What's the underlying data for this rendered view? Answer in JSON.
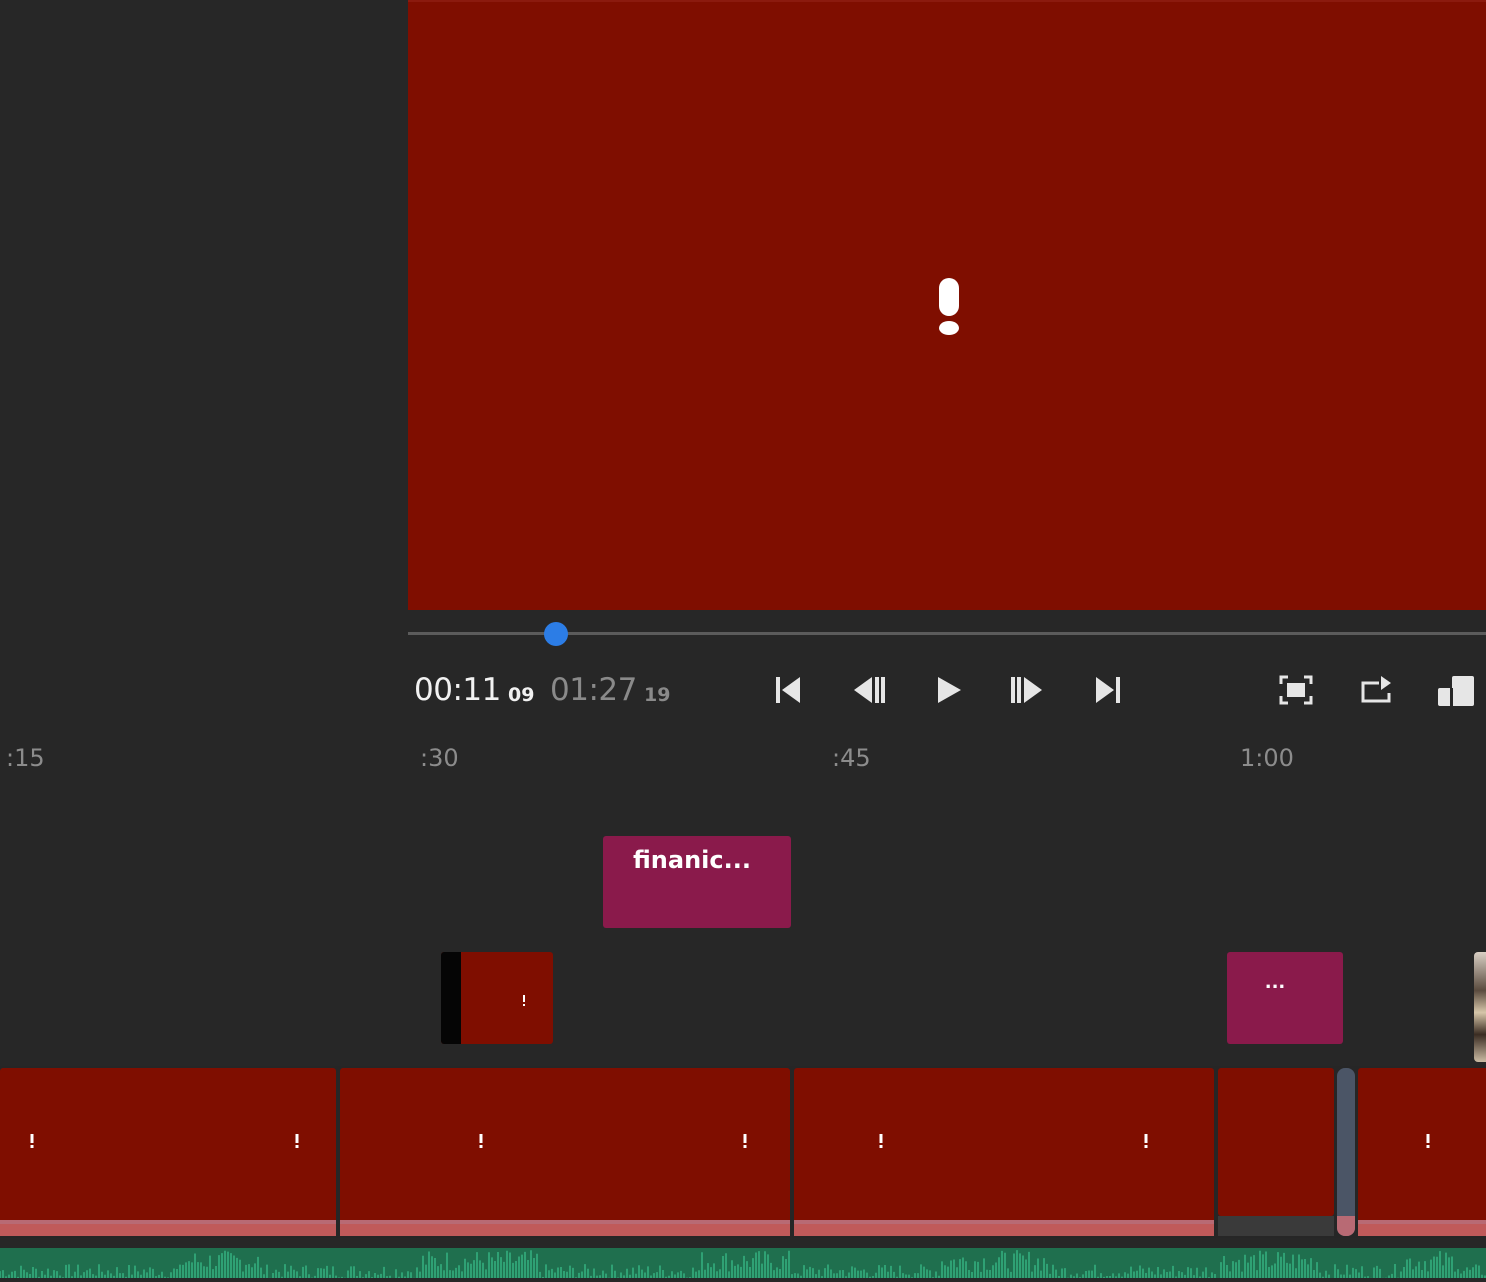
{
  "viewer": {
    "status_icon": "warning-exclamation-icon",
    "background_color": "#7f0e00"
  },
  "playhead": {
    "position_fraction": 0.137
  },
  "timecode": {
    "current": "00:11",
    "current_frames": "09",
    "total": "01:27",
    "total_frames": "19"
  },
  "controls": {
    "icons": [
      "skip-to-start-icon",
      "step-back-icon",
      "play-icon",
      "step-forward-icon",
      "skip-to-end-icon",
      "fit-to-screen-icon",
      "loop-icon",
      "picture-in-picture-icon"
    ]
  },
  "ruler": {
    "labels": [
      ":15",
      ":30",
      ":45",
      "1:00"
    ]
  },
  "clips": {
    "title_1": {
      "label": "finanic...",
      "color": "#8a1a4b"
    },
    "title_2": {
      "label": "...",
      "color": "#8a1a4b"
    },
    "video_small": {
      "color": "#7f0e00"
    },
    "main_color": "#7f0e00",
    "audio_color": "#1f6f4e"
  }
}
